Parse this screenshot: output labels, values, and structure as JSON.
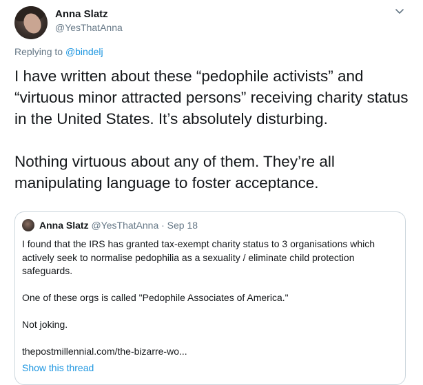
{
  "tweet": {
    "author_name": "Anna Slatz",
    "author_handle": "@YesThatAnna",
    "replying_prefix": "Replying to",
    "replying_to": "@bindelj",
    "paragraphs": [
      "I have written about these “pedophile activists” and “virtuous minor attracted persons” receiving charity status in the United States. It’s absolutely disturbing.",
      "Nothing virtuous about any of them. They’re all manipulating language to foster acceptance."
    ]
  },
  "quoted": {
    "author_name": "Anna Slatz",
    "author_handle": "@YesThatAnna",
    "date": "· Sep 18",
    "paragraphs": [
      "I found that the IRS has granted tax-exempt charity status to 3 organisations which actively seek to normalise pedophilia as a sexuality / eliminate child protection safeguards.",
      "One of these orgs is called \"Pedophile Associates of America.\"",
      "Not joking.",
      "thepostmillennial.com/the-bizarre-wo..."
    ],
    "show_thread": "Show this thread"
  },
  "icons": {
    "menu": "chevron-down-icon"
  },
  "colors": {
    "text": "#14171a",
    "secondary": "#657786",
    "link": "#1b95e0",
    "border": "#ccd6dd"
  }
}
